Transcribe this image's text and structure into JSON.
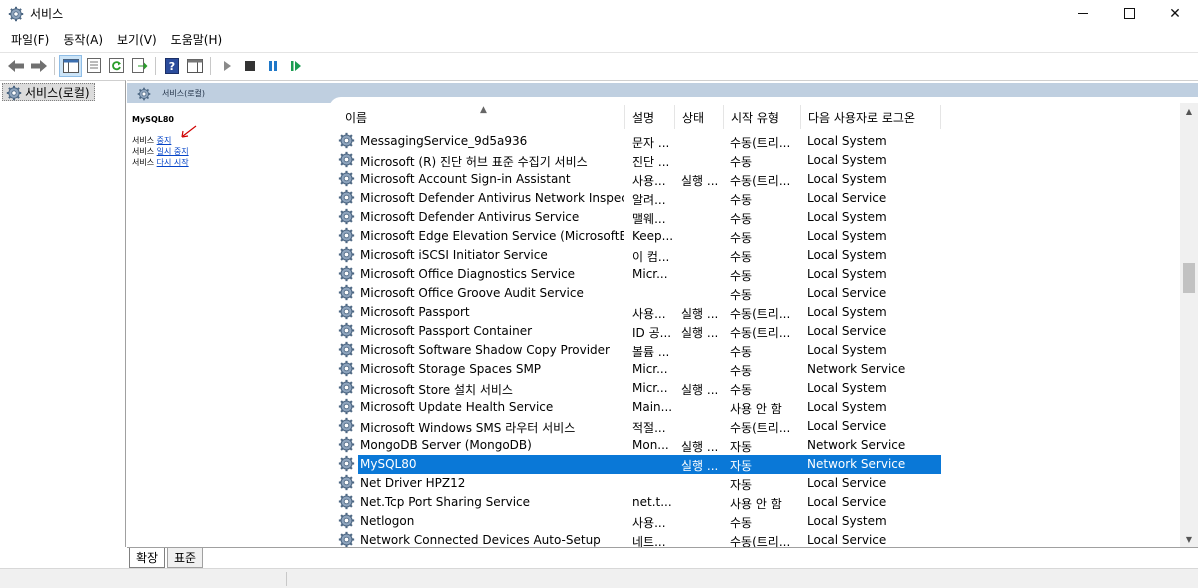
{
  "window": {
    "title": "서비스",
    "minimize_icon": "minimize-icon",
    "maximize_icon": "maximize-icon",
    "close_glyph": "✕"
  },
  "menu": {
    "items": [
      "파일(F)",
      "동작(A)",
      "보기(V)",
      "도움말(H)"
    ]
  },
  "toolbar": {
    "buttons": [
      "back-arrow-icon",
      "forward-arrow-icon",
      "show-hide-console-tree-icon",
      "properties-icon",
      "refresh-icon",
      "export-list-icon",
      "help-icon",
      "show-action-pane-icon",
      "start-service-icon",
      "stop-service-icon",
      "pause-service-icon",
      "restart-service-icon"
    ]
  },
  "tree": {
    "item": "서비스(로컬)"
  },
  "header_band": {
    "title": "서비스(로컬)"
  },
  "details": {
    "service_name": "MySQL80",
    "actions": [
      {
        "prefix": "서비스 ",
        "link": "중지"
      },
      {
        "prefix": "서비스 ",
        "link": "일시 중지"
      },
      {
        "prefix": "서비스 ",
        "link": "다시 시작"
      }
    ]
  },
  "columns": [
    "이름",
    "설명",
    "상태",
    "시작 유형",
    "다음 사용자로 로그온"
  ],
  "rows": [
    {
      "name": "MessagingService_9d5a936",
      "desc": "문자 ...",
      "status": "",
      "start": "수동(트리...",
      "logon": "Local System"
    },
    {
      "name": "Microsoft (R) 진단 허브 표준 수집기 서비스",
      "desc": "진단 ...",
      "status": "",
      "start": "수동",
      "logon": "Local System"
    },
    {
      "name": "Microsoft Account Sign-in Assistant",
      "desc": "사용...",
      "status": "실행 ...",
      "start": "수동(트리...",
      "logon": "Local System"
    },
    {
      "name": "Microsoft Defender Antivirus Network Inspecti...",
      "desc": "알려...",
      "status": "",
      "start": "수동",
      "logon": "Local Service"
    },
    {
      "name": "Microsoft Defender Antivirus Service",
      "desc": "맬웨...",
      "status": "",
      "start": "수동",
      "logon": "Local System"
    },
    {
      "name": "Microsoft Edge Elevation Service (MicrosoftEdg...",
      "desc": "Keep...",
      "status": "",
      "start": "수동",
      "logon": "Local System"
    },
    {
      "name": "Microsoft iSCSI Initiator Service",
      "desc": "이 컴...",
      "status": "",
      "start": "수동",
      "logon": "Local System"
    },
    {
      "name": "Microsoft Office Diagnostics Service",
      "desc": "Micr...",
      "status": "",
      "start": "수동",
      "logon": "Local System"
    },
    {
      "name": "Microsoft Office Groove Audit Service",
      "desc": "",
      "status": "",
      "start": "수동",
      "logon": "Local Service"
    },
    {
      "name": "Microsoft Passport",
      "desc": "사용...",
      "status": "실행 ...",
      "start": "수동(트리...",
      "logon": "Local System"
    },
    {
      "name": "Microsoft Passport Container",
      "desc": "ID 공...",
      "status": "실행 ...",
      "start": "수동(트리...",
      "logon": "Local Service"
    },
    {
      "name": "Microsoft Software Shadow Copy Provider",
      "desc": "볼륨 ...",
      "status": "",
      "start": "수동",
      "logon": "Local System"
    },
    {
      "name": "Microsoft Storage Spaces SMP",
      "desc": "Micr...",
      "status": "",
      "start": "수동",
      "logon": "Network Service"
    },
    {
      "name": "Microsoft Store 설치 서비스",
      "desc": "Micr...",
      "status": "실행 ...",
      "start": "수동",
      "logon": "Local System"
    },
    {
      "name": "Microsoft Update Health Service",
      "desc": "Main...",
      "status": "",
      "start": "사용 안 함",
      "logon": "Local System"
    },
    {
      "name": "Microsoft Windows SMS 라우터 서비스",
      "desc": "적절...",
      "status": "",
      "start": "수동(트리...",
      "logon": "Local Service"
    },
    {
      "name": "MongoDB Server (MongoDB)",
      "desc": "Mon...",
      "status": "실행 ...",
      "start": "자동",
      "logon": "Network Service"
    },
    {
      "name": "MySQL80",
      "desc": "",
      "status": "실행 ...",
      "start": "자동",
      "logon": "Network Service",
      "selected": true
    },
    {
      "name": "Net Driver HPZ12",
      "desc": "",
      "status": "",
      "start": "자동",
      "logon": "Local Service"
    },
    {
      "name": "Net.Tcp Port Sharing Service",
      "desc": "net.t...",
      "status": "",
      "start": "사용 안 함",
      "logon": "Local Service"
    },
    {
      "name": "Netlogon",
      "desc": "사용...",
      "status": "",
      "start": "수동",
      "logon": "Local System"
    },
    {
      "name": "Network Connected Devices Auto-Setup",
      "desc": "네트...",
      "status": "",
      "start": "수동(트리...",
      "logon": "Local Service"
    }
  ],
  "tabs": [
    "확장",
    "표준"
  ],
  "colors": {
    "selection": "#0a78d7",
    "header_band": "#bfcfe0",
    "link": "#0645c8",
    "annotation_arrow": "#d00000"
  }
}
